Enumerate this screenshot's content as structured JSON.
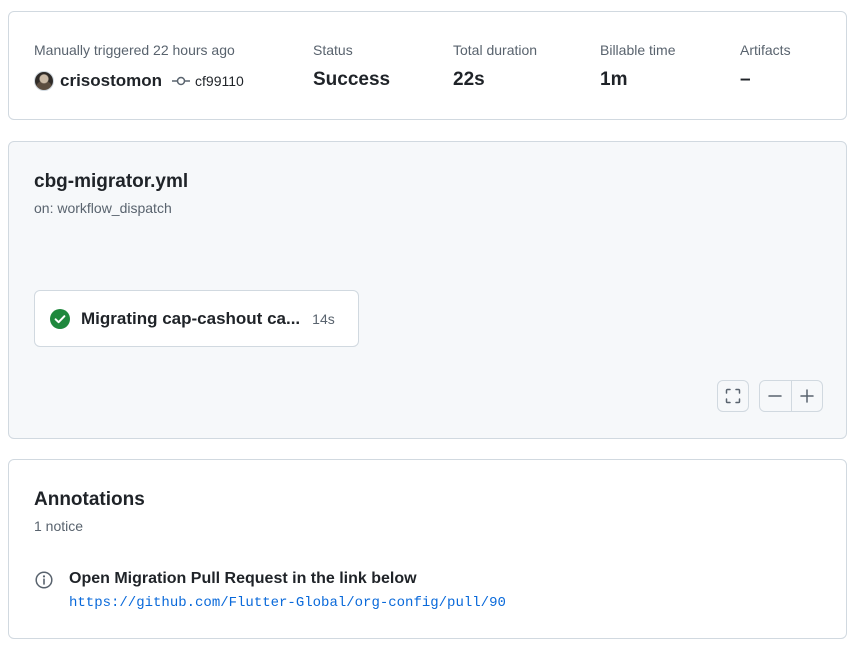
{
  "summary": {
    "trigger_label": "Manually triggered 22 hours ago",
    "actor": "crisostomon",
    "commit_sha": "cf99110",
    "status_label": "Status",
    "status_value": "Success",
    "duration_label": "Total duration",
    "duration_value": "22s",
    "billable_label": "Billable time",
    "billable_value": "1m",
    "artifacts_label": "Artifacts",
    "artifacts_value": "–"
  },
  "workflow": {
    "file_name": "cbg-migrator.yml",
    "trigger": "on: workflow_dispatch",
    "jobs": [
      {
        "name": "Migrating cap-cashout ca...",
        "duration": "14s",
        "status": "success"
      }
    ],
    "controls": {
      "fullscreen_icon": "fullscreen-icon",
      "zoom_out_icon": "zoom-out-icon",
      "zoom_in_icon": "zoom-in-icon"
    }
  },
  "annotations": {
    "title": "Annotations",
    "count_text": "1 notice",
    "items": [
      {
        "level": "notice",
        "icon": "info-icon",
        "title": "Open Migration Pull Request in the link below",
        "link": "https://github.com/Flutter-Global/org-config/pull/90"
      }
    ]
  },
  "colors": {
    "success": "#1f883d",
    "link": "#0969da",
    "muted_text": "#59636e",
    "border": "#d1d9e0",
    "graph_bg": "#f6f8fa"
  }
}
